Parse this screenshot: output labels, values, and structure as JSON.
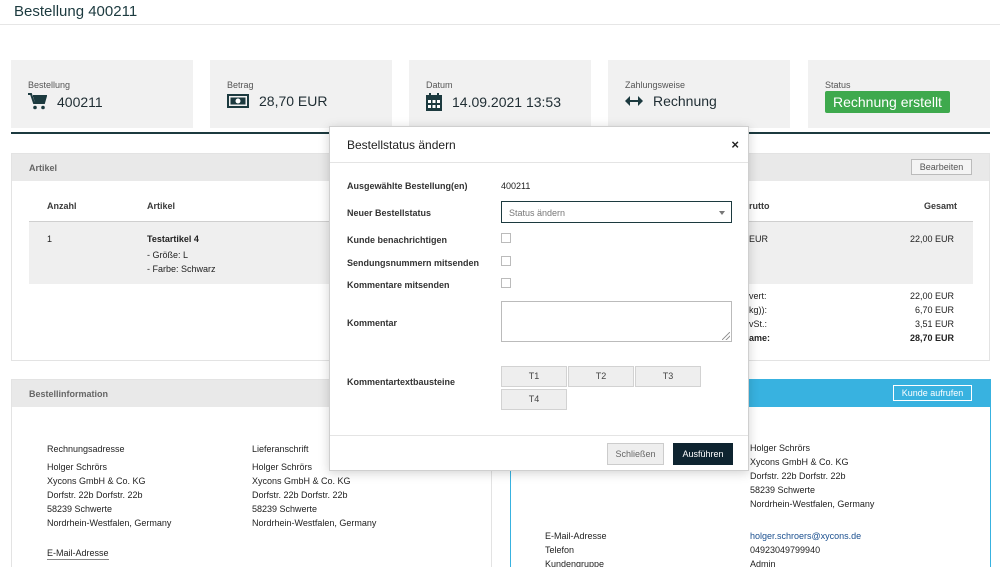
{
  "page": {
    "title": "Bestellung 400211"
  },
  "summary": {
    "order": {
      "label": "Bestellung",
      "value": "400211",
      "icon": "shopping-cart-icon"
    },
    "amount": {
      "label": "Betrag",
      "value": "28,70 EUR",
      "icon": "banknote-icon"
    },
    "date": {
      "label": "Datum",
      "value": "14.09.2021 13:53",
      "icon": "calendar-icon"
    },
    "payment": {
      "label": "Zahlungsweise",
      "value": "Rechnung",
      "icon": "arrows-horizontal-icon"
    },
    "status": {
      "label": "Status",
      "value": "Rechnung erstellt",
      "color": "#3ea94d"
    }
  },
  "articles": {
    "title": "Artikel",
    "edit_button": "Bearbeiten",
    "columns": {
      "qty": "Anzahl",
      "article": "Artikel",
      "brutto": "rutto",
      "total": "Gesamt"
    },
    "row": {
      "qty": "1",
      "name": "Testartikel 4",
      "size": "- Größe: L",
      "color": "- Farbe: Schwarz",
      "brutto": "EUR",
      "total": "22,00 EUR"
    },
    "totals": [
      {
        "label": "vert:",
        "value": "22,00 EUR"
      },
      {
        "label": "kg)):",
        "value": "6,70 EUR"
      },
      {
        "label": "vSt.:",
        "value": "3,51 EUR"
      },
      {
        "label": "ame:",
        "value": "28,70 EUR"
      }
    ]
  },
  "order_info": {
    "title": "Bestellinformation",
    "billing": {
      "heading": "Rechnungsadresse",
      "lines": [
        "Holger Schrörs",
        "Xycons GmbH & Co. KG",
        "Dorfstr. 22b Dorfstr. 22b",
        "58239 Schwerte",
        "Nordrhein-Westfalen, Germany"
      ]
    },
    "shipping": {
      "heading": "Lieferanschrift",
      "lines": [
        "Holger Schrörs",
        "Xycons GmbH & Co. KG",
        "Dorfstr. 22b Dorfstr. 22b",
        "58239 Schwerte",
        "Nordrhein-Westfalen, Germany"
      ]
    },
    "email_heading": "E-Mail-Adresse"
  },
  "customer": {
    "button": "Kunde aufrufen",
    "address_lines": [
      "Holger Schrörs",
      "Xycons GmbH & Co. KG",
      "Dorfstr. 22b Dorfstr. 22b",
      "58239 Schwerte",
      "Nordrhein-Westfalen, Germany"
    ],
    "email_label": "E-Mail-Adresse",
    "email": "holger.schroers@xycons.de",
    "phone_label": "Telefon",
    "phone": "04923049799940",
    "group_label": "Kundengruppe",
    "group": "Admin",
    "accent": "#38b2e0"
  },
  "modal": {
    "title": "Bestellstatus ändern",
    "close_glyph": "×",
    "selected_label": "Ausgewählte Bestellung(en)",
    "selected_value": "400211",
    "status_label": "Neuer Bestellstatus",
    "status_placeholder": "Status ändern",
    "notify_label": "Kunde benachrichtigen",
    "tracking_label": "Sendungsnummern mitsenden",
    "comments_label": "Kommentare mitsenden",
    "comment_label": "Kommentar",
    "snippets_label": "Kommentartextbausteine",
    "snippets": [
      "T1",
      "T2",
      "T3",
      "T4"
    ],
    "cancel": "Schließen",
    "submit": "Ausführen"
  }
}
